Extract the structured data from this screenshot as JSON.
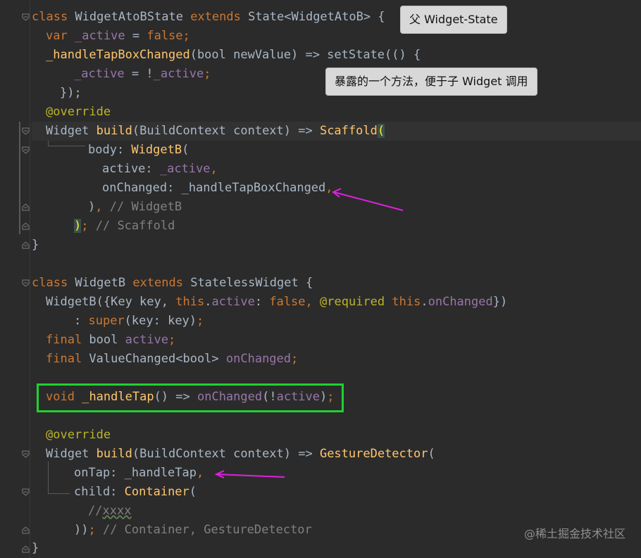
{
  "code": {
    "l1": {
      "kw": "class",
      "t1": " WidgetAtoBState ",
      "kw2": "extends",
      "t2": " State<WidgetAtoB> {"
    },
    "l2": {
      "kw": "var",
      "t1": " ",
      "f": "_active",
      "t2": " = ",
      "kw2": "false",
      "t3": ";"
    },
    "l3": {
      "fn": "_handleTapBoxChanged",
      "t1": "(bool newValue) => setState(() {"
    },
    "l4": {
      "f": "_active",
      "t1": " = !",
      "f2": "_active",
      "t2": ";"
    },
    "l5": {
      "t1": "});"
    },
    "l6": {
      "a": "@override"
    },
    "l7": {
      "t1": "Widget ",
      "fn": "build",
      "t2": "(BuildContext context) => ",
      "fn2": "Scaffold",
      "br": "("
    },
    "l8": {
      "t1": "body: ",
      "fn": "WidgetB",
      "t2": "("
    },
    "l9": {
      "t1": "active: ",
      "f": "_active",
      "k": ","
    },
    "l10": {
      "t1": "onChanged: _handleTapBoxChanged",
      "k": ","
    },
    "l11": {
      "t1": ")",
      "k": ",",
      "c": " // WidgetB"
    },
    "l12": {
      "br": ")",
      "k": ";",
      "c": " // Scaffold"
    },
    "l13": {
      "t1": "}"
    },
    "l14": {
      "kw": "class",
      "t1": " WidgetB ",
      "kw2": "extends",
      "t2": " StatelessWidget {"
    },
    "l15": {
      "t1": "WidgetB({Key key, ",
      "kw": "this",
      "t2": ".",
      "f": "active",
      "t3": ": ",
      "kw2": "false",
      "k": ",",
      "t4": " ",
      "a": "@required",
      "t5": " ",
      "kw3": "this",
      "t6": ".",
      "f2": "onChanged",
      "t7": "})"
    },
    "l16": {
      "t1": ": ",
      "kw": "super",
      "t2": "(key: key)",
      "k": ";"
    },
    "l17": {
      "kw": "final",
      "t1": " bool ",
      "f": "active",
      "k": ";"
    },
    "l18": {
      "kw": "final",
      "t1": " ValueChanged<bool> ",
      "f": "onChanged",
      "k": ";"
    },
    "l19": {
      "kw": "void",
      "t1": " ",
      "fn": "_handleTap",
      "t2": "() => ",
      "f": "onChanged",
      "t3": "(!",
      "f2": "active",
      "t4": ")",
      "k": ";"
    },
    "l20": {
      "a": "@override"
    },
    "l21": {
      "t1": "Widget ",
      "fn": "build",
      "t2": "(BuildContext context) => ",
      "fn2": "GestureDetector",
      "t3": "("
    },
    "l22": {
      "t1": "onTap: _handleTap",
      "k": ","
    },
    "l23": {
      "t1": "child: ",
      "fn": "Container",
      "t2": "("
    },
    "l24": {
      "c": "//",
      "c2": "xxxx"
    },
    "l25": {
      "t1": "))",
      "k": ";",
      "c": " // Container, GestureDetector"
    },
    "l26": {
      "t1": "}"
    }
  },
  "tooltips": {
    "parent_state": "父 Widget-State",
    "exposed_method": "暴露的一个方法，便于子 Widget 调用"
  },
  "watermark": "@稀土掘金技术社区",
  "colors": {
    "background": "#2b2b2b",
    "keyword": "#cc7832",
    "field": "#9876aa",
    "function": "#ffc66d",
    "annotation": "#bbb529",
    "comment": "#808080",
    "highlight_box": "#1fd131",
    "arrow": "#e020e0"
  }
}
